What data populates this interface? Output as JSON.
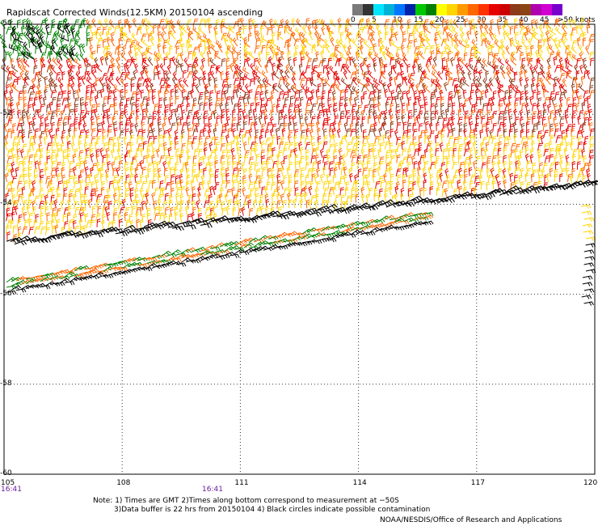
{
  "title": "Rapidscat Corrected Winds(12.5KM) 20150104 ascending",
  "legend": {
    "swatches": [
      {
        "label": "0",
        "color": "#7a7a7a",
        "dark": "#333333"
      },
      {
        "label": "5",
        "color": "#00e5ff",
        "dark": "#00b3d6"
      },
      {
        "label": "10",
        "color": "#0077ff",
        "dark": "#0022aa"
      },
      {
        "label": "15",
        "color": "#00c800",
        "dark": "#008000"
      },
      {
        "label": "20",
        "color": "#ffff00",
        "dark": "#ffd400"
      },
      {
        "label": "25",
        "color": "#ff9900",
        "dark": "#ff6600"
      },
      {
        "label": "30",
        "color": "#ff3300",
        "dark": "#e60000"
      },
      {
        "label": "35",
        "color": "#cc0000",
        "dark": "#8b3a1a"
      },
      {
        "label": "40",
        "color": "#8b4513",
        "dark": "#b000b0"
      },
      {
        "label": "45",
        "color": "#d000d0",
        "dark": "#7a00cc"
      },
      {
        "label": ">50 knots",
        "color": "#5a00b0",
        "dark": "#5a00b0"
      }
    ]
  },
  "map": {
    "lat_labels": [
      "-50",
      "-52",
      "-54",
      "-56",
      "-58",
      "-60"
    ],
    "lon_labels": [
      "105",
      "108",
      "111",
      "114",
      "117",
      "120"
    ],
    "time_labels": [
      "16:41",
      "16:41"
    ]
  },
  "notes": [
    "Note: 1) Times are GMT 2)Times along bottom correspond to measurement at −50S",
    "3)Data buffer is 22 hrs from 20150104 4) Black circles indicate possible contamination"
  ],
  "credit": "NOAA/NESDIS/Office of Research and Applications"
}
